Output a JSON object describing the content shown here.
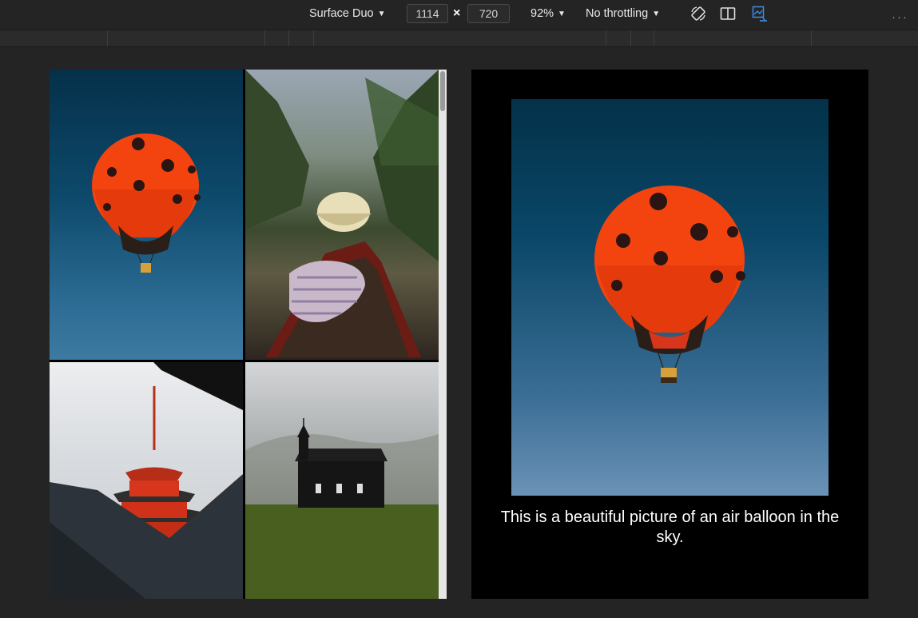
{
  "toolbar": {
    "device": "Surface Duo",
    "width_value": "1114",
    "times": "×",
    "height_value": "720",
    "zoom": "92%",
    "throttling": "No throttling",
    "caret": "▼",
    "more": "···",
    "icons": [
      "rotate-icon",
      "dual-screen-icon",
      "inspect-media-icon",
      "more-icon"
    ],
    "accent_color": "#3d8ee6"
  },
  "gallery": {
    "images": [
      {
        "subject": "hot-air-balloon"
      },
      {
        "subject": "woman-in-boat"
      },
      {
        "subject": "red-pagoda"
      },
      {
        "subject": "black-church"
      }
    ]
  },
  "detail": {
    "caption": "This is a beautiful picture of an air balloon in the sky."
  }
}
